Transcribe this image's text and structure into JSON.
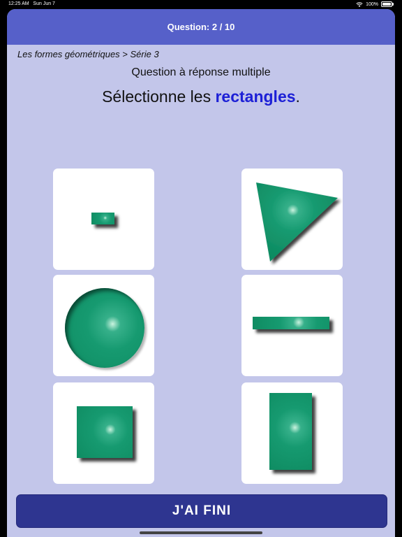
{
  "status_bar": {
    "time": "12:25 AM",
    "date": "Sun Jun 7",
    "battery": "100%"
  },
  "header": {
    "question_label": "Question: 2 / 10"
  },
  "breadcrumb": "Les formes géométriques > Série 3",
  "subtitle": "Question à réponse multiple",
  "instruction": {
    "prefix": "Sélectionne les ",
    "highlight": "rectangles",
    "suffix": "."
  },
  "answers": [
    {
      "shape": "small-rectangle"
    },
    {
      "shape": "triangle"
    },
    {
      "shape": "circle"
    },
    {
      "shape": "thin-rectangle"
    },
    {
      "shape": "square"
    },
    {
      "shape": "tall-rectangle"
    }
  ],
  "done_button": {
    "label": "J'AI FINI"
  },
  "colors": {
    "accent": "#5660c9",
    "shape_fill": "#169a70",
    "highlight": "#1d20d6",
    "button": "#2e3590",
    "background": "#c3c6ea"
  }
}
